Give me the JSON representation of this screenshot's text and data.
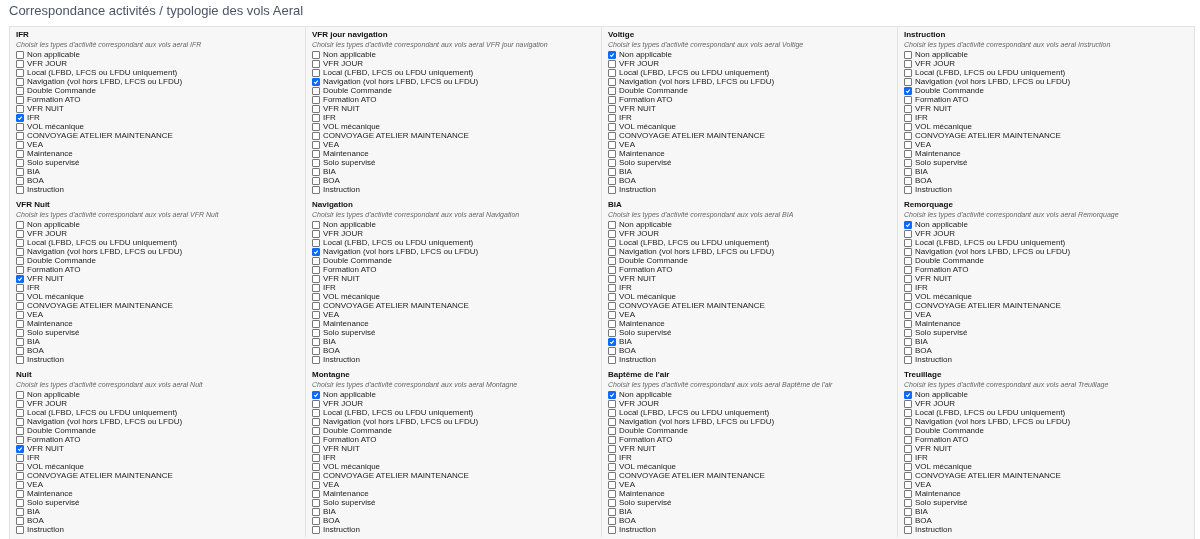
{
  "page_title": "Correspondance activités / typologie des vols Aeral",
  "groups": [
    {
      "title": "IFR",
      "description": "Choisir les types d'activité correspondant aux vols aeral IFR",
      "options": [
        {
          "label": "Non applicable",
          "checked": false
        },
        {
          "label": "VFR JOUR",
          "checked": false
        },
        {
          "label": "Local (LFBD, LFCS ou LFDU uniquement)",
          "checked": false
        },
        {
          "label": "Navigation (vol hors LFBD, LFCS ou LFDU)",
          "checked": false
        },
        {
          "label": "Double Commande",
          "checked": false
        },
        {
          "label": "Formation ATO",
          "checked": false
        },
        {
          "label": "VFR NUIT",
          "checked": false
        },
        {
          "label": "IFR",
          "checked": true
        },
        {
          "label": "VOL mécanique",
          "checked": false
        },
        {
          "label": "CONVOYAGE ATELIER MAINTENANCE",
          "checked": false
        },
        {
          "label": "VEA",
          "checked": false
        },
        {
          "label": "Maintenance",
          "checked": false
        },
        {
          "label": "Solo supervisé",
          "checked": false
        },
        {
          "label": "BIA",
          "checked": false
        },
        {
          "label": "BOA",
          "checked": false
        },
        {
          "label": "Instruction",
          "checked": false
        }
      ]
    },
    {
      "title": "VFR jour navigation",
      "description": "Choisir les types d'activité correspondant aux vols aeral VFR jour navigation",
      "options": [
        {
          "label": "Non applicable",
          "checked": false
        },
        {
          "label": "VFR JOUR",
          "checked": false
        },
        {
          "label": "Local (LFBD, LFCS ou LFDU uniquement)",
          "checked": false
        },
        {
          "label": "Navigation (vol hors LFBD, LFCS ou LFDU)",
          "checked": true
        },
        {
          "label": "Double Commande",
          "checked": false
        },
        {
          "label": "Formation ATO",
          "checked": false
        },
        {
          "label": "VFR NUIT",
          "checked": false
        },
        {
          "label": "IFR",
          "checked": false
        },
        {
          "label": "VOL mécanique",
          "checked": false
        },
        {
          "label": "CONVOYAGE ATELIER MAINTENANCE",
          "checked": false
        },
        {
          "label": "VEA",
          "checked": false
        },
        {
          "label": "Maintenance",
          "checked": false
        },
        {
          "label": "Solo supervisé",
          "checked": false
        },
        {
          "label": "BIA",
          "checked": false
        },
        {
          "label": "BOA",
          "checked": false
        },
        {
          "label": "Instruction",
          "checked": false
        }
      ]
    },
    {
      "title": "Voltige",
      "description": "Choisir les types d'activité correspondant aux vols aeral Voltige",
      "options": [
        {
          "label": "Non applicable",
          "checked": true
        },
        {
          "label": "VFR JOUR",
          "checked": false
        },
        {
          "label": "Local (LFBD, LFCS ou LFDU uniquement)",
          "checked": false
        },
        {
          "label": "Navigation (vol hors LFBD, LFCS ou LFDU)",
          "checked": false
        },
        {
          "label": "Double Commande",
          "checked": false
        },
        {
          "label": "Formation ATO",
          "checked": false
        },
        {
          "label": "VFR NUIT",
          "checked": false
        },
        {
          "label": "IFR",
          "checked": false
        },
        {
          "label": "VOL mécanique",
          "checked": false
        },
        {
          "label": "CONVOYAGE ATELIER MAINTENANCE",
          "checked": false
        },
        {
          "label": "VEA",
          "checked": false
        },
        {
          "label": "Maintenance",
          "checked": false
        },
        {
          "label": "Solo supervisé",
          "checked": false
        },
        {
          "label": "BIA",
          "checked": false
        },
        {
          "label": "BOA",
          "checked": false
        },
        {
          "label": "Instruction",
          "checked": false
        }
      ]
    },
    {
      "title": "Instruction",
      "description": "Choisir les types d'activité correspondant aux vols aeral Instruction",
      "options": [
        {
          "label": "Non applicable",
          "checked": false
        },
        {
          "label": "VFR JOUR",
          "checked": false
        },
        {
          "label": "Local (LFBD, LFCS ou LFDU uniquement)",
          "checked": false
        },
        {
          "label": "Navigation (vol hors LFBD, LFCS ou LFDU)",
          "checked": false
        },
        {
          "label": "Double Commande",
          "checked": true
        },
        {
          "label": "Formation ATO",
          "checked": false
        },
        {
          "label": "VFR NUIT",
          "checked": false
        },
        {
          "label": "IFR",
          "checked": false
        },
        {
          "label": "VOL mécanique",
          "checked": false
        },
        {
          "label": "CONVOYAGE ATELIER MAINTENANCE",
          "checked": false
        },
        {
          "label": "VEA",
          "checked": false
        },
        {
          "label": "Maintenance",
          "checked": false
        },
        {
          "label": "Solo supervisé",
          "checked": false
        },
        {
          "label": "BIA",
          "checked": false
        },
        {
          "label": "BOA",
          "checked": false
        },
        {
          "label": "Instruction",
          "checked": false
        }
      ]
    },
    {
      "title": "VFR Nuit",
      "description": "Choisir les types d'activité correspondant aux vols aeral VFR Nuit",
      "options": [
        {
          "label": "Non applicable",
          "checked": false
        },
        {
          "label": "VFR JOUR",
          "checked": false
        },
        {
          "label": "Local (LFBD, LFCS ou LFDU uniquement)",
          "checked": false
        },
        {
          "label": "Navigation (vol hors LFBD, LFCS ou LFDU)",
          "checked": false
        },
        {
          "label": "Double Commande",
          "checked": false
        },
        {
          "label": "Formation ATO",
          "checked": false
        },
        {
          "label": "VFR NUIT",
          "checked": true
        },
        {
          "label": "IFR",
          "checked": false
        },
        {
          "label": "VOL mécanique",
          "checked": false
        },
        {
          "label": "CONVOYAGE ATELIER MAINTENANCE",
          "checked": false
        },
        {
          "label": "VEA",
          "checked": false
        },
        {
          "label": "Maintenance",
          "checked": false
        },
        {
          "label": "Solo supervisé",
          "checked": false
        },
        {
          "label": "BIA",
          "checked": false
        },
        {
          "label": "BOA",
          "checked": false
        },
        {
          "label": "Instruction",
          "checked": false
        }
      ]
    },
    {
      "title": "Navigation",
      "description": "Choisir les types d'activité correspondant aux vols aeral Navigation",
      "options": [
        {
          "label": "Non applicable",
          "checked": false
        },
        {
          "label": "VFR JOUR",
          "checked": false
        },
        {
          "label": "Local (LFBD, LFCS ou LFDU uniquement)",
          "checked": false
        },
        {
          "label": "Navigation (vol hors LFBD, LFCS ou LFDU)",
          "checked": true
        },
        {
          "label": "Double Commande",
          "checked": false
        },
        {
          "label": "Formation ATO",
          "checked": false
        },
        {
          "label": "VFR NUIT",
          "checked": false
        },
        {
          "label": "IFR",
          "checked": false
        },
        {
          "label": "VOL mécanique",
          "checked": false
        },
        {
          "label": "CONVOYAGE ATELIER MAINTENANCE",
          "checked": false
        },
        {
          "label": "VEA",
          "checked": false
        },
        {
          "label": "Maintenance",
          "checked": false
        },
        {
          "label": "Solo supervisé",
          "checked": false
        },
        {
          "label": "BIA",
          "checked": false
        },
        {
          "label": "BOA",
          "checked": false
        },
        {
          "label": "Instruction",
          "checked": false
        }
      ]
    },
    {
      "title": "BIA",
      "description": "Choisir les types d'activité correspondant aux vols aeral BIA",
      "options": [
        {
          "label": "Non applicable",
          "checked": false
        },
        {
          "label": "VFR JOUR",
          "checked": false
        },
        {
          "label": "Local (LFBD, LFCS ou LFDU uniquement)",
          "checked": false
        },
        {
          "label": "Navigation (vol hors LFBD, LFCS ou LFDU)",
          "checked": false
        },
        {
          "label": "Double Commande",
          "checked": false
        },
        {
          "label": "Formation ATO",
          "checked": false
        },
        {
          "label": "VFR NUIT",
          "checked": false
        },
        {
          "label": "IFR",
          "checked": false
        },
        {
          "label": "VOL mécanique",
          "checked": false
        },
        {
          "label": "CONVOYAGE ATELIER MAINTENANCE",
          "checked": false
        },
        {
          "label": "VEA",
          "checked": false
        },
        {
          "label": "Maintenance",
          "checked": false
        },
        {
          "label": "Solo supervisé",
          "checked": false
        },
        {
          "label": "BIA",
          "checked": true
        },
        {
          "label": "BOA",
          "checked": false
        },
        {
          "label": "Instruction",
          "checked": false
        }
      ]
    },
    {
      "title": "Remorquage",
      "description": "Choisir les types d'activité correspondant aux vols aeral Remorquage",
      "options": [
        {
          "label": "Non applicable",
          "checked": true
        },
        {
          "label": "VFR JOUR",
          "checked": false
        },
        {
          "label": "Local (LFBD, LFCS ou LFDU uniquement)",
          "checked": false
        },
        {
          "label": "Navigation (vol hors LFBD, LFCS ou LFDU)",
          "checked": false
        },
        {
          "label": "Double Commande",
          "checked": false
        },
        {
          "label": "Formation ATO",
          "checked": false
        },
        {
          "label": "VFR NUIT",
          "checked": false
        },
        {
          "label": "IFR",
          "checked": false
        },
        {
          "label": "VOL mécanique",
          "checked": false
        },
        {
          "label": "CONVOYAGE ATELIER MAINTENANCE",
          "checked": false
        },
        {
          "label": "VEA",
          "checked": false
        },
        {
          "label": "Maintenance",
          "checked": false
        },
        {
          "label": "Solo supervisé",
          "checked": false
        },
        {
          "label": "BIA",
          "checked": false
        },
        {
          "label": "BOA",
          "checked": false
        },
        {
          "label": "Instruction",
          "checked": false
        }
      ]
    },
    {
      "title": "Nuit",
      "description": "Choisir les types d'activité correspondant aux vols aeral Nuit",
      "options": [
        {
          "label": "Non applicable",
          "checked": false
        },
        {
          "label": "VFR JOUR",
          "checked": false
        },
        {
          "label": "Local (LFBD, LFCS ou LFDU uniquement)",
          "checked": false
        },
        {
          "label": "Navigation (vol hors LFBD, LFCS ou LFDU)",
          "checked": false
        },
        {
          "label": "Double Commande",
          "checked": false
        },
        {
          "label": "Formation ATO",
          "checked": false
        },
        {
          "label": "VFR NUIT",
          "checked": true
        },
        {
          "label": "IFR",
          "checked": false
        },
        {
          "label": "VOL mécanique",
          "checked": false
        },
        {
          "label": "CONVOYAGE ATELIER MAINTENANCE",
          "checked": false
        },
        {
          "label": "VEA",
          "checked": false
        },
        {
          "label": "Maintenance",
          "checked": false
        },
        {
          "label": "Solo supervisé",
          "checked": false
        },
        {
          "label": "BIA",
          "checked": false
        },
        {
          "label": "BOA",
          "checked": false
        },
        {
          "label": "Instruction",
          "checked": false
        }
      ]
    },
    {
      "title": "Montagne",
      "description": "Choisir les types d'activité correspondant aux vols aeral Montagne",
      "options": [
        {
          "label": "Non applicable",
          "checked": true
        },
        {
          "label": "VFR JOUR",
          "checked": false
        },
        {
          "label": "Local (LFBD, LFCS ou LFDU uniquement)",
          "checked": false
        },
        {
          "label": "Navigation (vol hors LFBD, LFCS ou LFDU)",
          "checked": false
        },
        {
          "label": "Double Commande",
          "checked": false
        },
        {
          "label": "Formation ATO",
          "checked": false
        },
        {
          "label": "VFR NUIT",
          "checked": false
        },
        {
          "label": "IFR",
          "checked": false
        },
        {
          "label": "VOL mécanique",
          "checked": false
        },
        {
          "label": "CONVOYAGE ATELIER MAINTENANCE",
          "checked": false
        },
        {
          "label": "VEA",
          "checked": false
        },
        {
          "label": "Maintenance",
          "checked": false
        },
        {
          "label": "Solo supervisé",
          "checked": false
        },
        {
          "label": "BIA",
          "checked": false
        },
        {
          "label": "BOA",
          "checked": false
        },
        {
          "label": "Instruction",
          "checked": false
        }
      ]
    },
    {
      "title": "Baptême de l'air",
      "description": "Choisir les types d'activité correspondant aux vols aeral Baptême de l'air",
      "options": [
        {
          "label": "Non applicable",
          "checked": true
        },
        {
          "label": "VFR JOUR",
          "checked": false
        },
        {
          "label": "Local (LFBD, LFCS ou LFDU uniquement)",
          "checked": false
        },
        {
          "label": "Navigation (vol hors LFBD, LFCS ou LFDU)",
          "checked": false
        },
        {
          "label": "Double Commande",
          "checked": false
        },
        {
          "label": "Formation ATO",
          "checked": false
        },
        {
          "label": "VFR NUIT",
          "checked": false
        },
        {
          "label": "IFR",
          "checked": false
        },
        {
          "label": "VOL mécanique",
          "checked": false
        },
        {
          "label": "CONVOYAGE ATELIER MAINTENANCE",
          "checked": false
        },
        {
          "label": "VEA",
          "checked": false
        },
        {
          "label": "Maintenance",
          "checked": false
        },
        {
          "label": "Solo supervisé",
          "checked": false
        },
        {
          "label": "BIA",
          "checked": false
        },
        {
          "label": "BOA",
          "checked": false
        },
        {
          "label": "Instruction",
          "checked": false
        }
      ]
    },
    {
      "title": "Treuillage",
      "description": "Choisir les types d'activité correspondant aux vols aeral Treuillage",
      "options": [
        {
          "label": "Non applicable",
          "checked": true
        },
        {
          "label": "VFR JOUR",
          "checked": false
        },
        {
          "label": "Local (LFBD, LFCS ou LFDU uniquement)",
          "checked": false
        },
        {
          "label": "Navigation (vol hors LFBD, LFCS ou LFDU)",
          "checked": false
        },
        {
          "label": "Double Commande",
          "checked": false
        },
        {
          "label": "Formation ATO",
          "checked": false
        },
        {
          "label": "VFR NUIT",
          "checked": false
        },
        {
          "label": "IFR",
          "checked": false
        },
        {
          "label": "VOL mécanique",
          "checked": false
        },
        {
          "label": "CONVOYAGE ATELIER MAINTENANCE",
          "checked": false
        },
        {
          "label": "VEA",
          "checked": false
        },
        {
          "label": "Maintenance",
          "checked": false
        },
        {
          "label": "Solo supervisé",
          "checked": false
        },
        {
          "label": "BIA",
          "checked": false
        },
        {
          "label": "BOA",
          "checked": false
        },
        {
          "label": "Instruction",
          "checked": false
        }
      ]
    }
  ]
}
